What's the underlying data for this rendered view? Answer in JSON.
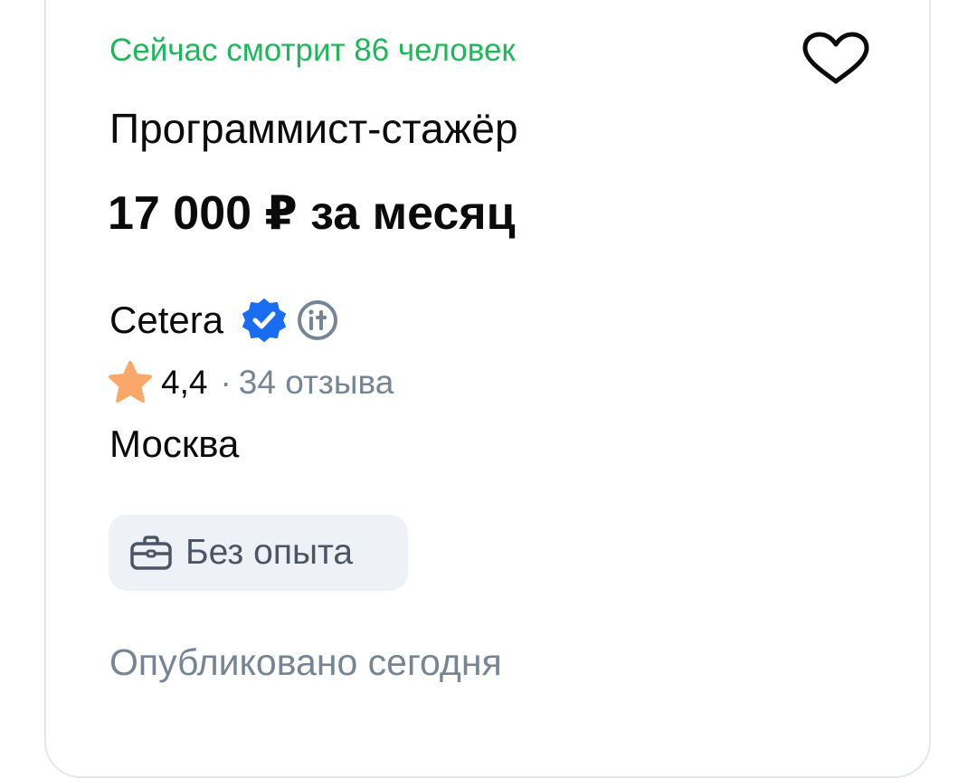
{
  "vacancy": {
    "viewers_text": "Сейчас смотрит 86 человек",
    "title": "Программист-стажёр",
    "salary": "17 000 ₽ за месяц",
    "company": {
      "name": "Cetera",
      "verified_icon": "verified-badge-icon",
      "it_badge_icon": "it-company-icon"
    },
    "rating": {
      "icon": "star-icon",
      "value": "4,4",
      "separator": "·",
      "reviews": "34 отзыва"
    },
    "city": "Москва",
    "experience_tag": {
      "icon": "briefcase-icon",
      "label": "Без опыта"
    },
    "published": "Опубликовано сегодня",
    "favorite_icon": "heart-outline-icon"
  },
  "colors": {
    "viewers_green": "#1eb85a",
    "verified_blue": "#1a6cf0",
    "star_orange": "#f9a86a",
    "muted_gray": "#768596",
    "tag_background": "#eef2f7",
    "text_black": "#0b0b0c"
  }
}
